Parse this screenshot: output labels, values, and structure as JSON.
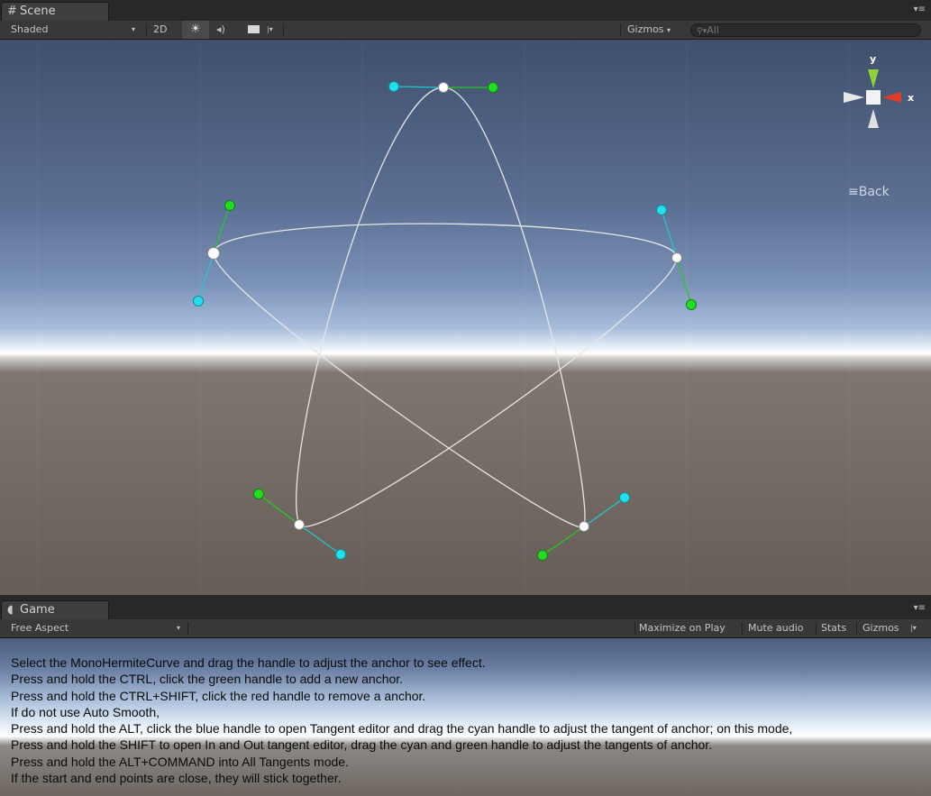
{
  "scene_tab": {
    "title": "Scene",
    "icon": "grid-icon"
  },
  "scene_toolbar": {
    "shading_mode": "Shaded",
    "mode_2d": "2D",
    "lighting_icon": "sun-icon",
    "audio_icon": "speaker-icon",
    "effects_icon": "image-icon",
    "gizmos_label": "Gizmos",
    "search_placeholder": "All"
  },
  "orientation_gizmo": {
    "y_label": "y",
    "x_label": "x",
    "view_label": "Back",
    "colors": {
      "y": "#8ed23a",
      "x": "#e03c2a",
      "neutral": "#e8e8e8"
    }
  },
  "curve": {
    "curve_color": "#e6e6e6",
    "anchor_color": "#ffffff",
    "in_handle_color": "#20e0ee",
    "out_handle_color": "#22dd22",
    "anchor_count": 5
  },
  "game_tab": {
    "title": "Game",
    "icon": "pacman-icon"
  },
  "game_toolbar": {
    "aspect": "Free Aspect",
    "maximize_on_play": "Maximize on Play",
    "mute_audio": "Mute audio",
    "stats": "Stats",
    "gizmos": "Gizmos"
  },
  "instructions": [
    "Select the MonoHermiteCurve and drag the handle to adjust the anchor to see effect.",
    "Press and hold the CTRL, click the green handle to add a new anchor.",
    "Press and hold the CTRL+SHIFT, click the red handle to remove a anchor.",
    "If do not use Auto Smooth,",
    "Press and hold the ALT, click the blue handle to open Tangent editor and drag the cyan handle to adjust the tangent of anchor; on this mode,",
    "Press and hold the SHIFT to open In and Out tangent editor, drag the cyan and green handle to adjust the tangents of anchor.",
    "Press and hold the ALT+COMMAND into All Tangents mode.",
    "If the start and end points are close, they will stick together."
  ]
}
